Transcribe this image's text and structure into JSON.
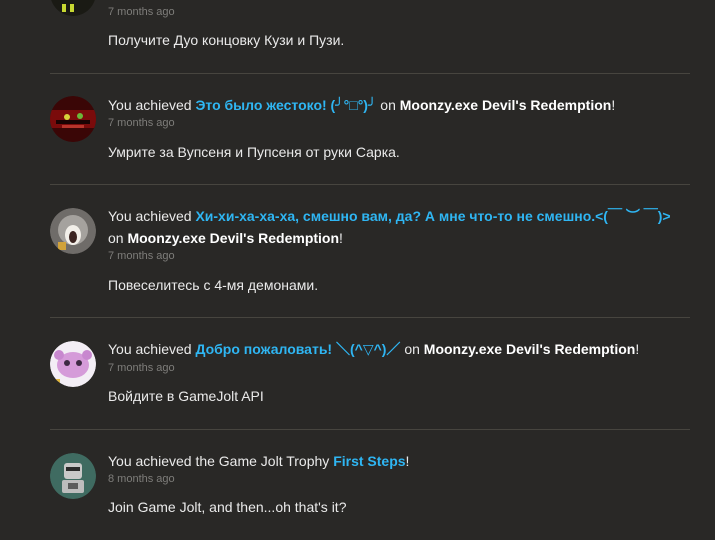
{
  "feed": {
    "entries": [
      {
        "time": "7 months ago",
        "description": "Получите Дуо концовку Кузи и Пузи."
      },
      {
        "prefix": "You achieved",
        "trophy": "Это было жестоко! (╯°□°)╯",
        "on": "on",
        "game": "Moonzy.exe Devil's Redemption",
        "suffix": "!",
        "time": "7 months ago",
        "description": "Умрите за Вупсеня и Пупсеня от руки Сарка."
      },
      {
        "prefix": "You achieved",
        "trophy": "Хи-хи-ха-ха-ха, смешно вам, да? А мне что-то не смешно.<(￣ ︶ ￣)>",
        "on": "on",
        "game": "Moonzy.exe Devil's Redemption",
        "suffix": "!",
        "time": "7 months ago",
        "description": "Повеселитесь с 4-мя демонами."
      },
      {
        "prefix": "You achieved",
        "trophy": "Добро пожаловать! ＼(^▽^)／",
        "on": "on",
        "game": "Moonzy.exe Devil's Redemption",
        "suffix": "!",
        "time": "7 months ago",
        "description": "Войдите в GameJolt API"
      },
      {
        "prefix": "You achieved the Game Jolt Trophy",
        "trophy": "First Steps",
        "suffix": "!",
        "time": "8 months ago",
        "description": "Join Game Jolt, and then...oh that's it?"
      }
    ]
  },
  "colors": {
    "background": "#292826",
    "trophy_link": "#2fb6f3",
    "timestamp": "#7e7d7a",
    "divider": "#47453f"
  },
  "icons": [
    "game-avatar-icon",
    "dark-scene-avatar-icon",
    "screaming-face-avatar-icon",
    "pink-creature-avatar-icon",
    "gamejolt-robot-avatar-icon"
  ]
}
